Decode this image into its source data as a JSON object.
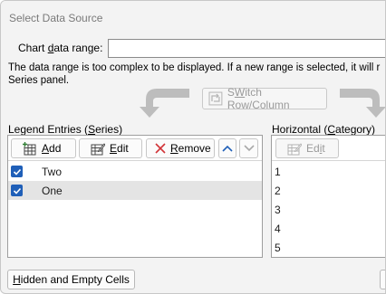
{
  "window": {
    "title": "Select Data Source"
  },
  "chart_range": {
    "label_pre": "Chart ",
    "label_ul": "d",
    "label_post": "ata range:",
    "value": ""
  },
  "message": {
    "line1": "The data range is too complex to be displayed. If a new range is selected, it will r",
    "line2": "Series panel."
  },
  "switch_button": {
    "label_ul": "W",
    "label_pre": "S",
    "label_post": "itch Row/Column",
    "disabled": true
  },
  "legend": {
    "label_pre": "Legend Entries (",
    "label_ul": "S",
    "label_post": "eries)",
    "add": {
      "label_ul": "A",
      "label_post": "dd"
    },
    "edit": {
      "label_ul": "E",
      "label_post": "dit"
    },
    "remove": {
      "label_ul": "R",
      "label_post": "emove"
    },
    "series": [
      {
        "name": "Two",
        "checked": true,
        "selected": false
      },
      {
        "name": "One",
        "checked": true,
        "selected": true
      }
    ]
  },
  "category": {
    "label_pre": "Horizontal (",
    "label_ul": "C",
    "label_post": "ategory) Ax",
    "edit": {
      "label_ul": "i",
      "label_pre": "Ed",
      "label_post": "t",
      "disabled": true
    },
    "items": [
      "1",
      "2",
      "3",
      "4",
      "5"
    ]
  },
  "hidden_cells_button": {
    "label_ul": "H",
    "label_post": "idden and Empty Cells"
  },
  "colors": {
    "accent": "#1f5fb8",
    "remove_x": "#d13438",
    "title_text": "#7a7a7a"
  }
}
